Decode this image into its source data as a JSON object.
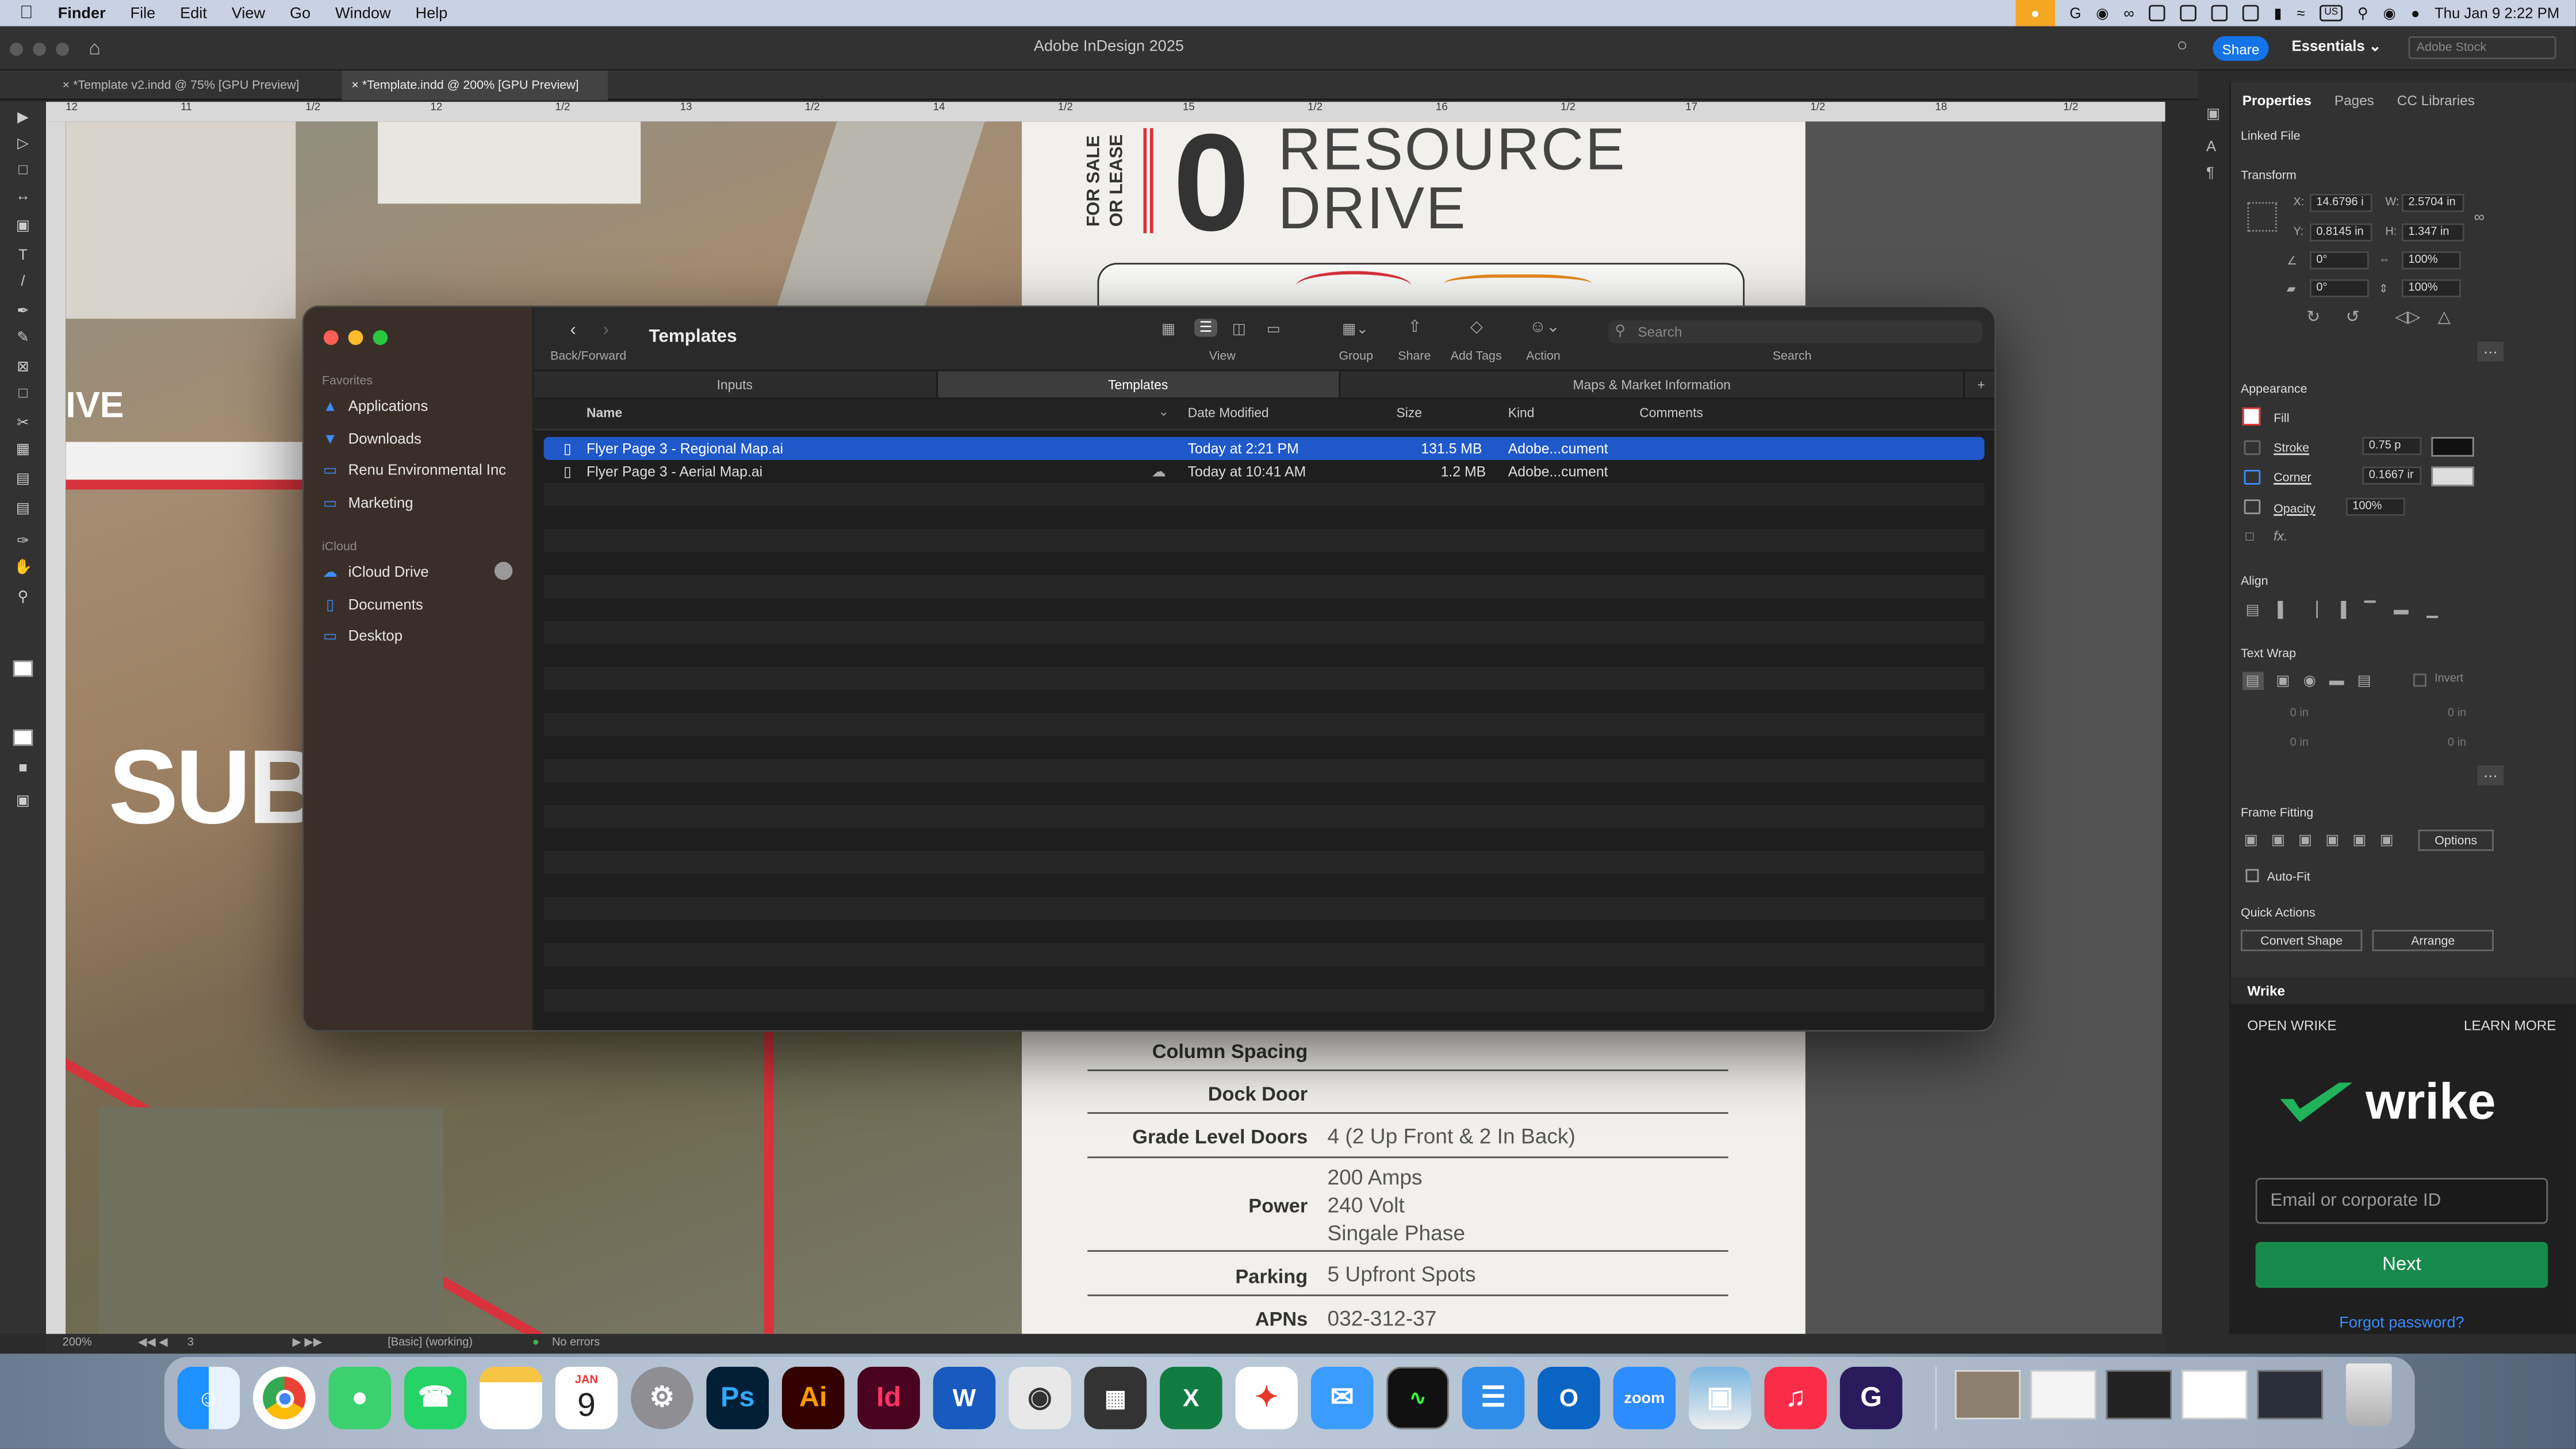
{
  "menubar": {
    "app": "Finder",
    "items": [
      "File",
      "Edit",
      "View",
      "Go",
      "Window",
      "Help"
    ],
    "clock": "Thu Jan 9  2:22 PM",
    "input_source": "US"
  },
  "app_window": {
    "title": "Adobe InDesign 2025",
    "share": "Share",
    "workspace": "Essentials",
    "stock_placeholder": "Adobe Stock"
  },
  "doc_tabs": [
    "*Template v2.indd @ 75% [GPU Preview]",
    "*Template.indd @ 200% [GPU Preview]"
  ],
  "ruler": {
    "labels": [
      "12",
      "11",
      "1/2",
      "12",
      "1/2",
      "13",
      "1/2",
      "14",
      "1/2",
      "15",
      "1/2",
      "16",
      "1/2",
      "17",
      "1/2",
      "18",
      "1/2"
    ]
  },
  "layout_text": {
    "aerial_ive": "IVE",
    "aerial_sub": "SUB",
    "for_sale": "FOR SALE",
    "or_lease": "OR LEASE",
    "zero": "0",
    "resource": "RESOURCE",
    "drive": "DRIVE"
  },
  "specs": [
    {
      "label": "Column Spacing",
      "value": ""
    },
    {
      "label": "Dock Door",
      "value": ""
    },
    {
      "label": "Grade Level Doors",
      "value": "4 (2 Up Front & 2 In Back)"
    },
    {
      "label": "Power",
      "value": "200 Amps\n240 Volt\nSingale Phase"
    },
    {
      "label": "Parking",
      "value": "5 Upfront Spots"
    },
    {
      "label": "APNs",
      "value": "032-312-37"
    }
  ],
  "finder": {
    "title": "Templates",
    "nav_label": "Back/Forward",
    "toolbar": {
      "view": "View",
      "group": "Group",
      "share": "Share",
      "add_tags": "Add Tags",
      "action": "Action",
      "search_label": "Search"
    },
    "search_placeholder": "Search",
    "tabs": [
      "Inputs",
      "Templates",
      "Maps & Market Information"
    ],
    "columns": [
      "Name",
      "Date Modified",
      "Size",
      "Kind",
      "Comments"
    ],
    "favorites_label": "Favorites",
    "favorites": [
      "Applications",
      "Downloads",
      "Renu Environmental Inc",
      "Marketing"
    ],
    "icloud_label": "iCloud",
    "icloud": [
      "iCloud Drive",
      "Documents",
      "Desktop"
    ],
    "files": [
      {
        "name": "Flyer Page 3 - Regional Map.ai",
        "date": "Today at 2:21 PM",
        "size": "131.5 MB",
        "kind": "Adobe...cument"
      },
      {
        "name": "Flyer Page 3 - Aerial Map.ai",
        "date": "Today at 10:41 AM",
        "size": "1.2 MB",
        "kind": "Adobe...cument"
      }
    ]
  },
  "properties": {
    "tabs": [
      "Properties",
      "Pages",
      "CC Libraries"
    ],
    "linked_file": "Linked File",
    "transform": "Transform",
    "x": "14.6796 i",
    "w": "2.5704 in",
    "y": "0.8145 in",
    "h": "1.347 in",
    "rotate": "0°",
    "shear": "0°",
    "scale_x": "100%",
    "scale_y": "100%",
    "appearance": "Appearance",
    "fill": "Fill",
    "stroke": "Stroke",
    "stroke_val": "0.75 p",
    "corner": "Corner",
    "corner_val": "0.1667 ir",
    "opacity": "Opacity",
    "opacity_val": "100%",
    "fx": "fx.",
    "align": "Align",
    "text_wrap": "Text Wrap",
    "invert": "Invert",
    "wrap_vals": [
      "0 in",
      "0 in",
      "0 in",
      "0 in"
    ],
    "frame_fitting": "Frame Fitting",
    "options": "Options",
    "auto_fit": "Auto-Fit",
    "quick_actions": "Quick Actions",
    "convert_shape": "Convert Shape",
    "arrange": "Arrange"
  },
  "wrike": {
    "header": "Wrike",
    "open": "OPEN WRIKE",
    "learn": "LEARN MORE",
    "logo": "wrike",
    "email_placeholder": "Email or corporate ID",
    "next": "Next",
    "forgot": "Forgot password?"
  },
  "status": {
    "zoom": "200%",
    "page": "3",
    "style": "[Basic] (working)",
    "errors": "No errors"
  },
  "dock": {
    "calendar_month": "JAN",
    "calendar_day": "9",
    "apps": [
      "Finder",
      "Chrome",
      "Messages",
      "WhatsApp",
      "Notes",
      "Calendar",
      "System Settings",
      "Photoshop",
      "Illustrator",
      "InDesign",
      "Word",
      "Screenshot",
      "Calculator",
      "Excel",
      "Acrobat",
      "Mail",
      "Activity Monitor",
      "Notepad",
      "Outlook",
      "Zoom",
      "Preview",
      "Music",
      "Grammarly"
    ],
    "labels": {
      "ps": "Ps",
      "ai": "Ai",
      "id": "Id",
      "word": "W",
      "excel": "X",
      "outlook": "O",
      "zoom": "zoom",
      "grammarly": "G"
    }
  },
  "colors": {
    "accent": "#1473e6",
    "selection": "#1f59c9",
    "wrike_green": "#168a4a",
    "red_stripe": "#d8323c"
  }
}
